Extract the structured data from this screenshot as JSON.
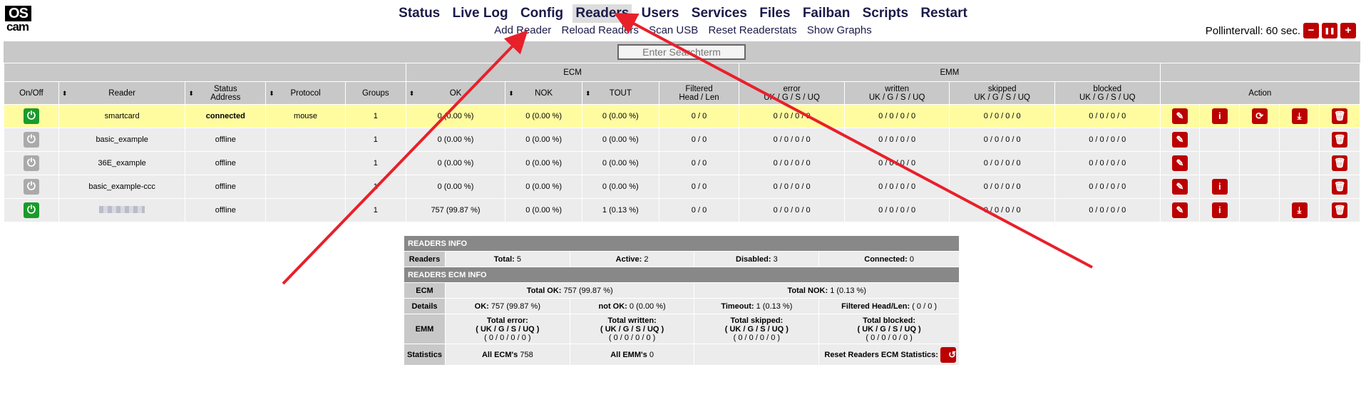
{
  "logo": {
    "top": "OS",
    "bottom": "cam"
  },
  "menu": [
    "Status",
    "Live Log",
    "Config",
    "Readers",
    "Users",
    "Services",
    "Files",
    "Failban",
    "Scripts",
    "Restart"
  ],
  "submenu": [
    "Add Reader",
    "Reload Readers",
    "Scan USB",
    "Reset Readerstats",
    "Show Graphs"
  ],
  "poll": {
    "label": "Pollintervall:",
    "value": "60 sec.",
    "buttons": [
      "−",
      "❚❚",
      "+"
    ]
  },
  "search": {
    "placeholder": "Enter Searchterm"
  },
  "headers": {
    "ecm": "ECM",
    "emm": "EMM",
    "onoff": "On/Off",
    "reader": "Reader",
    "status1": "Status",
    "status2": "Address",
    "protocol": "Protocol",
    "groups": "Groups",
    "ok": "OK",
    "nok": "NOK",
    "tout": "TOUT",
    "filt1": "Filtered",
    "filt2": "Head / Len",
    "error": "error",
    "written": "written",
    "skipped": "skipped",
    "blocked": "blocked",
    "ugsu": "UK / G / S / UQ",
    "action": "Action"
  },
  "readers": [
    {
      "name": "smartcard",
      "status": "connected",
      "protocol": "mouse",
      "groups": "1",
      "ok": "0 (0.00 %)",
      "nok": "0 (0.00 %)",
      "tout": "0 (0.00 %)",
      "filt": "0 / 0",
      "error": "0 / 0 / 0 / 0",
      "written": "0 / 0 / 0 / 0",
      "skipped": "0 / 0 / 0 / 0",
      "blocked": "0 / 0 / 0 / 0"
    },
    {
      "name": "basic_example",
      "status": "offline",
      "protocol": "",
      "groups": "1",
      "ok": "0 (0.00 %)",
      "nok": "0 (0.00 %)",
      "tout": "0 (0.00 %)",
      "filt": "0 / 0",
      "error": "0 / 0 / 0 / 0",
      "written": "0 / 0 / 0 / 0",
      "skipped": "0 / 0 / 0 / 0",
      "blocked": "0 / 0 / 0 / 0"
    },
    {
      "name": "36E_example",
      "status": "offline",
      "protocol": "",
      "groups": "1",
      "ok": "0 (0.00 %)",
      "nok": "0 (0.00 %)",
      "tout": "0 (0.00 %)",
      "filt": "0 / 0",
      "error": "0 / 0 / 0 / 0",
      "written": "0 / 0 / 0 / 0",
      "skipped": "0 / 0 / 0 / 0",
      "blocked": "0 / 0 / 0 / 0"
    },
    {
      "name": "basic_example-ccc",
      "status": "offline",
      "protocol": "",
      "groups": "1",
      "ok": "0 (0.00 %)",
      "nok": "0 (0.00 %)",
      "tout": "0 (0.00 %)",
      "filt": "0 / 0",
      "error": "0 / 0 / 0 / 0",
      "written": "0 / 0 / 0 / 0",
      "skipped": "0 / 0 / 0 / 0",
      "blocked": "0 / 0 / 0 / 0"
    },
    {
      "name": "",
      "status": "offline",
      "protocol": "",
      "groups": "1",
      "ok": "757 (99.87 %)",
      "nok": "0 (0.00 %)",
      "tout": "1 (0.13 %)",
      "filt": "0 / 0",
      "error": "0 / 0 / 0 / 0",
      "written": "0 / 0 / 0 / 0",
      "skipped": "0 / 0 / 0 / 0",
      "blocked": "0 / 0 / 0 / 0"
    }
  ],
  "info": {
    "readers_info": "READERS INFO",
    "readers_lbl": "Readers",
    "total_lbl": "Total:",
    "total": "5",
    "active_lbl": "Active:",
    "active": "2",
    "disabled_lbl": "Disabled:",
    "disabled": "3",
    "connected_lbl": "Connected:",
    "connected": "0",
    "ecm_info": "READERS ECM INFO",
    "ecm_lbl": "ECM",
    "total_ok_lbl": "Total OK:",
    "total_ok": "757 (99.87 %)",
    "total_nok_lbl": "Total NOK:",
    "total_nok": "1 (0.13 %)",
    "details_lbl": "Details",
    "ok_lbl": "OK:",
    "ok": "757 (99.87 %)",
    "notok_lbl": "not OK:",
    "notok": "0 (0.00 %)",
    "timeout_lbl": "Timeout:",
    "timeout": "1 (0.13 %)",
    "filtered_lbl": "Filtered Head/Len:",
    "filtered": "( 0 / 0 )",
    "emm_lbl": "EMM",
    "terr": "Total error:",
    "twri": "Total written:",
    "tski": "Total skipped:",
    "tblk": "Total blocked:",
    "ugsu": "( UK / G / S / UQ )",
    "zeros": "( 0 / 0 / 0 / 0 )",
    "stats_lbl": "Statistics",
    "all_ecm_lbl": "All ECM's",
    "all_ecm": "758",
    "all_emm_lbl": "All EMM's",
    "all_emm": "0",
    "reset_lbl": "Reset Readers ECM Statistics:"
  },
  "colors": {
    "accent_red": "#bb0000",
    "power_on": "#1a9b2a",
    "arrow": "#e8202a"
  }
}
